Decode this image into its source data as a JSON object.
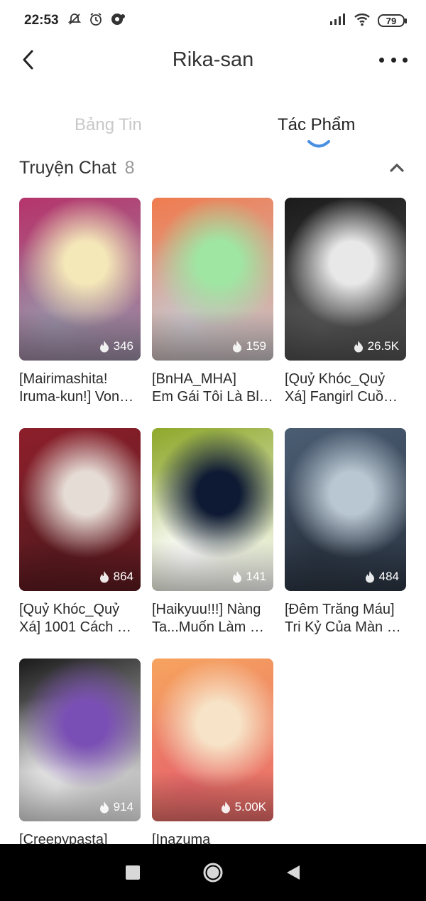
{
  "status_bar": {
    "time": "22:53",
    "icons_left": [
      "bell-off-icon",
      "alarm-icon",
      "messenger-icon"
    ],
    "icons_right": [
      "signal-icon",
      "wifi-icon"
    ],
    "battery": "79"
  },
  "header": {
    "title": "Rika-san",
    "back_icon": "chevron-left-icon",
    "more_icon": "more-horizontal-icon"
  },
  "tabs": [
    {
      "label": "Bảng Tin",
      "active": false
    },
    {
      "label": "Tác Phẩm",
      "active": true
    }
  ],
  "section": {
    "title": "Truyện Chat",
    "count": "8"
  },
  "stories": [
    {
      "title": "[Mairimashita!\nIruma-kun!] Von…",
      "views": "346",
      "colors": [
        "#b5346b",
        "#f4e7b8",
        "#9a8fa6"
      ]
    },
    {
      "title": "[BnHA_MHA]\nEm Gái Tôi Là Bl…",
      "views": "159",
      "colors": [
        "#f07b4f",
        "#9fe6a3",
        "#c9c4c9"
      ]
    },
    {
      "title": "[Quỷ Khóc_Quỷ\nXá] Fangirl Cuồ…",
      "views": "26.5K",
      "colors": [
        "#1b1b1b",
        "#e8e8e8",
        "#555555"
      ]
    },
    {
      "title": "[Quỷ Khóc_Quỷ\nXá] 1001 Cách …",
      "views": "864",
      "colors": [
        "#8c1f2b",
        "#e6dcd6",
        "#5b1a1f"
      ]
    },
    {
      "title": "[Haikyuu!!!] Nàng\nTa...Muốn Làm …",
      "views": "141",
      "colors": [
        "#8ea82a",
        "#0e1a33",
        "#ffffff"
      ]
    },
    {
      "title": "[Đêm Trăng Máu]\nTri Kỷ Của Màn …",
      "views": "484",
      "colors": [
        "#4b5d73",
        "#b9c7d2",
        "#2b3543"
      ]
    },
    {
      "title": "[Creepypasta]",
      "views": "914",
      "colors": [
        "#1a1a1a",
        "#7a4fb5",
        "#f2f2f2"
      ]
    },
    {
      "title": "[Inazuma",
      "views": "5.00K",
      "colors": [
        "#f6a35f",
        "#f7e3c7",
        "#e86a6a"
      ]
    }
  ],
  "nav_bar": {
    "buttons": [
      "recent-apps-icon",
      "home-icon",
      "back-triangle-icon"
    ]
  }
}
